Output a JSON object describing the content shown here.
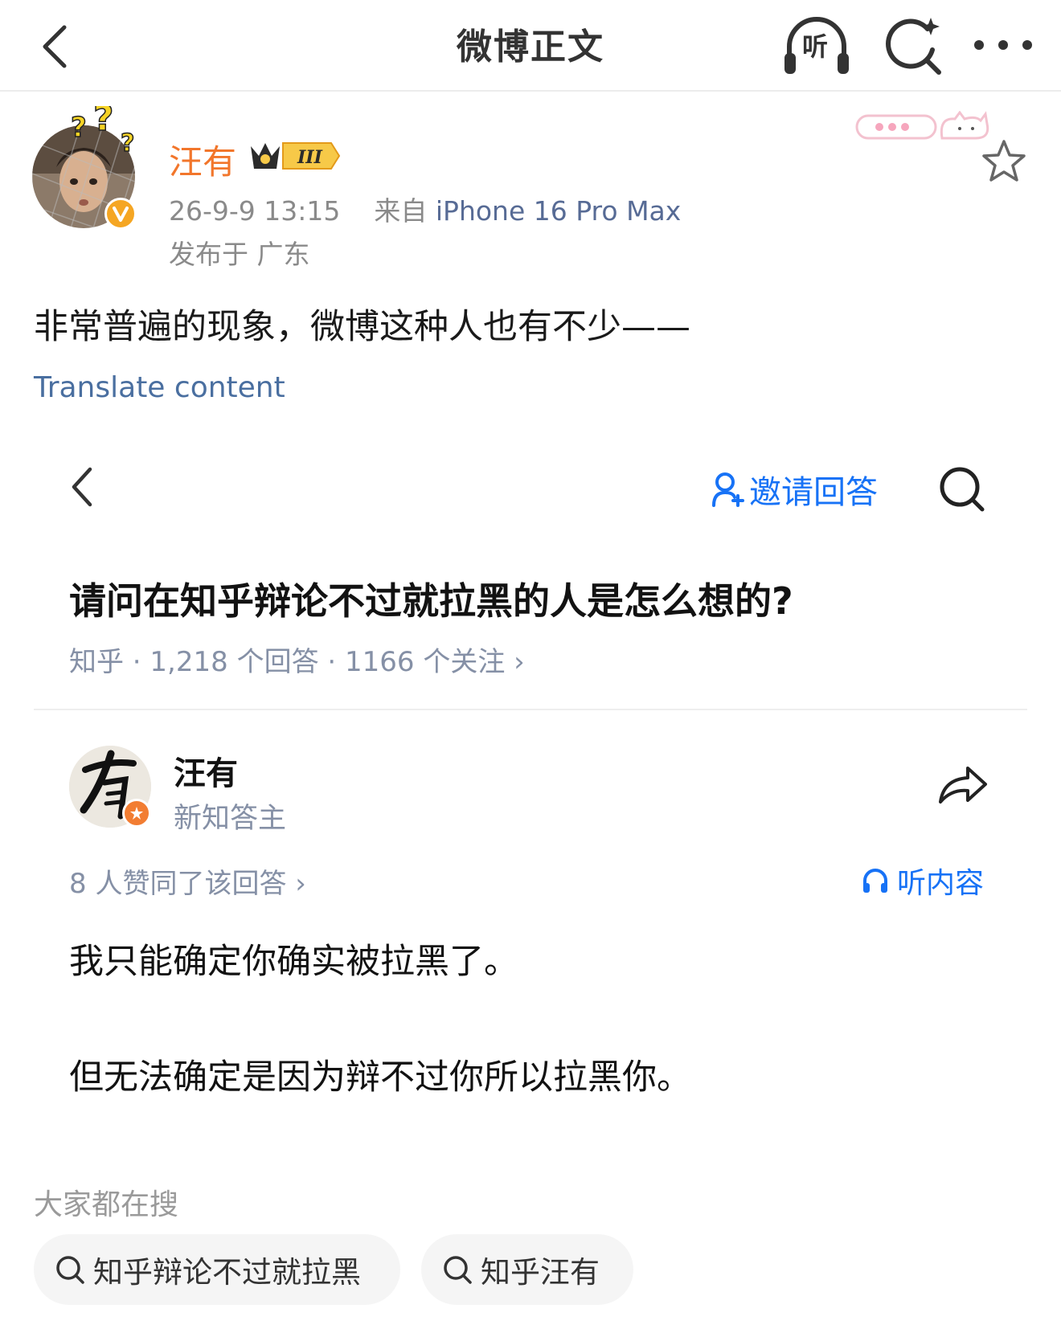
{
  "nav": {
    "title": "微博正文",
    "listen_label": "听"
  },
  "post": {
    "author": "汪有",
    "timestamp": "26-9-9 13:15",
    "source_prefix": "来自",
    "source": "iPhone 16 Pro Max",
    "location": "发布于 广东",
    "vip_level": "III",
    "text": "非常普遍的现象，微博这种人也有不少——",
    "translate_label": "Translate content"
  },
  "embed": {
    "invite_label": "邀请回答",
    "question": "请问在知乎辩论不过就拉黑的人是怎么想的?",
    "question_meta": "知乎 · 1,218 个回答 · 1166 个关注 ›",
    "answerer_name": "汪有",
    "answerer_title": "新知答主",
    "votes": "8 人赞同了该回答 ›",
    "listen_label": "听内容",
    "answer_line1": "我只能确定你确实被拉黑了。",
    "answer_line2": "但无法确定是因为辩不过你所以拉黑你。"
  },
  "trending": {
    "title": "大家都在搜",
    "chips": [
      "知乎辩论不过就拉黑",
      "知乎汪有"
    ]
  },
  "colors": {
    "username": "#f2762b",
    "link_blue": "#4a6fa0",
    "zhihu_blue": "#1772f6",
    "meta_gray": "#8a8a8a"
  }
}
